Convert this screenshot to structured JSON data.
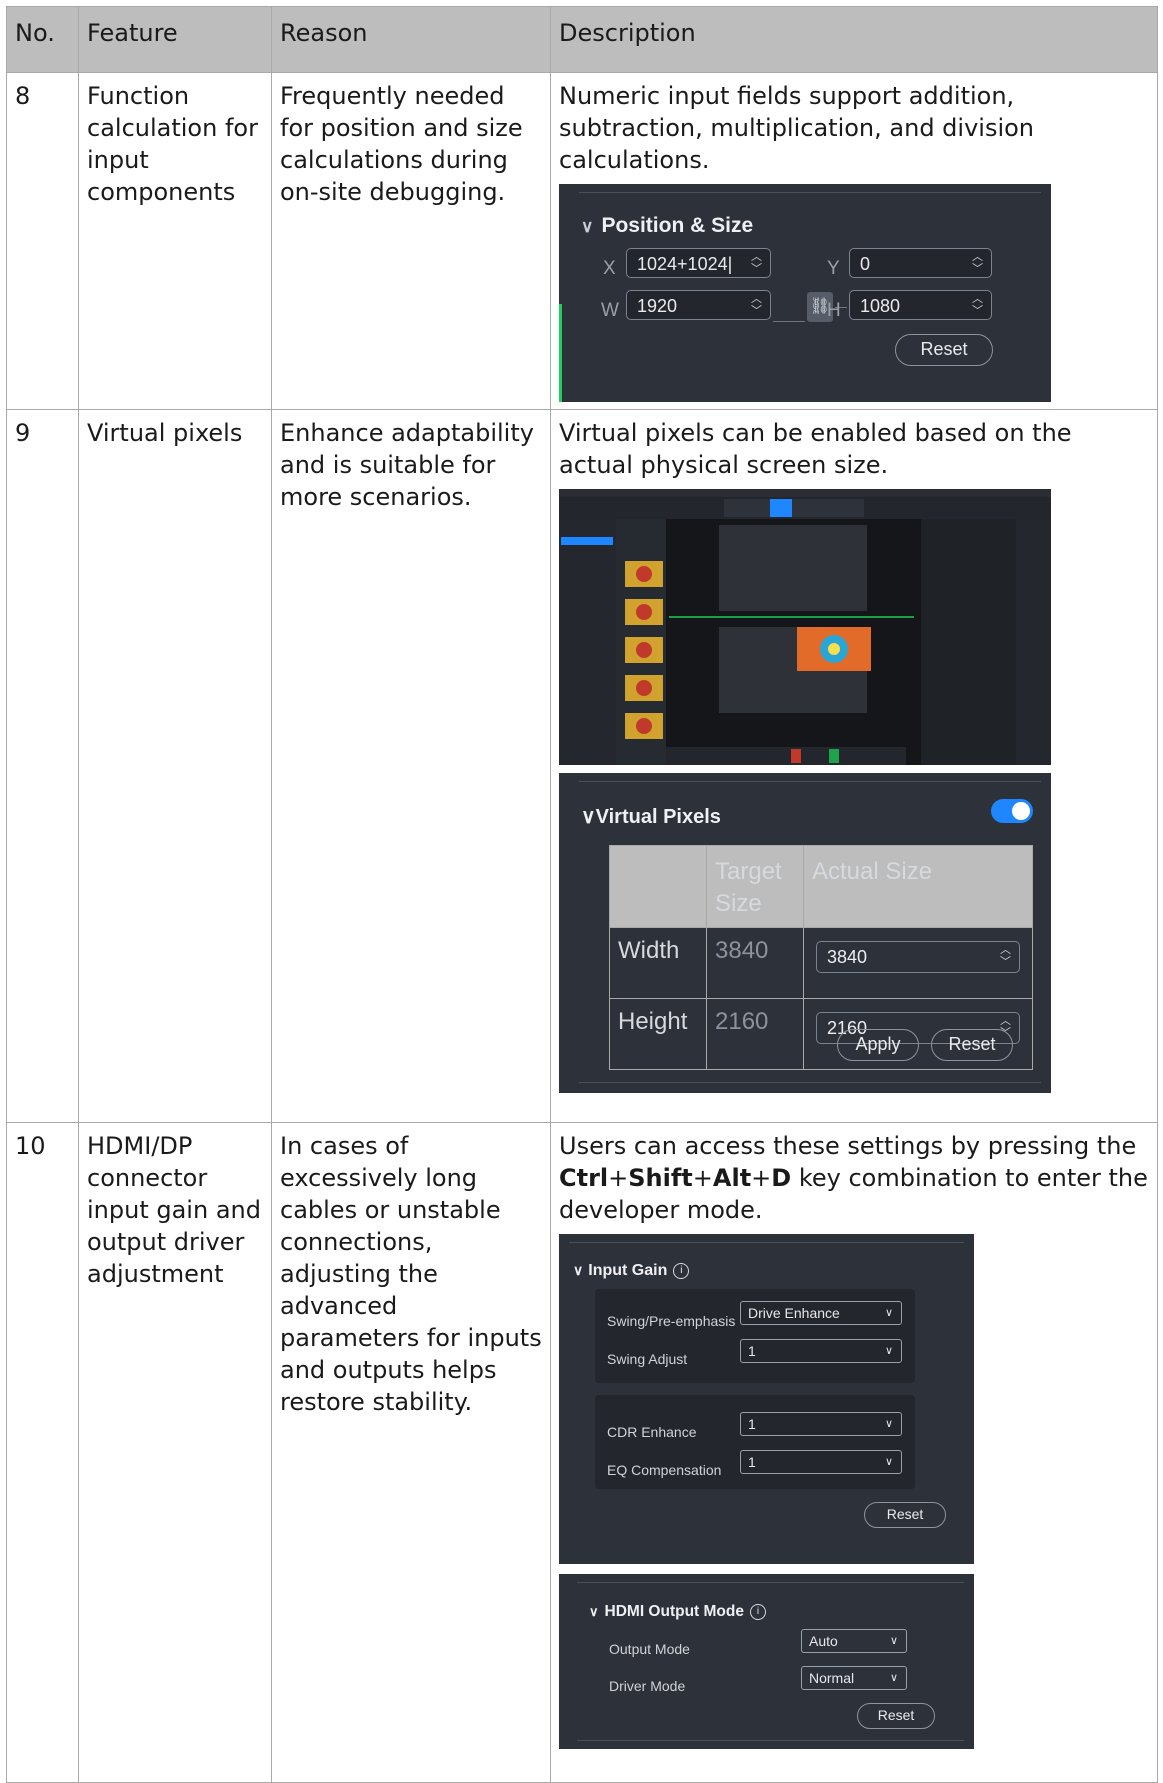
{
  "header": {
    "no": "No.",
    "feature": "Feature",
    "reason": "Reason",
    "description": "Description"
  },
  "rows": [
    {
      "no": "8",
      "feature": "Function calculation for input components",
      "reason": "Frequently needed for position and size calculations during on-site debugging.",
      "description": "Numeric input fields support addition, subtraction, multiplication, and division calculations.",
      "panel": {
        "title": "Position & Size",
        "x_label": "X",
        "x_value": "1024+1024",
        "y_label": "Y",
        "y_value": "0",
        "w_label": "W",
        "w_value": "1920",
        "h_label": "H",
        "h_value": "1080",
        "reset": "Reset"
      }
    },
    {
      "no": "9",
      "feature": "Virtual pixels",
      "reason": "Enhance adaptability and is suitable for more scenarios.",
      "description": "Virtual pixels can be enabled based on the actual physical screen size.",
      "panel": {
        "title": "Virtual Pixels",
        "enabled": true,
        "col_target": "Target Size",
        "col_actual": "Actual Size",
        "rows": [
          {
            "label": "Width",
            "target": "3840",
            "actual": "3840"
          },
          {
            "label": "Height",
            "target": "2160",
            "actual": "2160"
          }
        ],
        "apply": "Apply",
        "reset": "Reset"
      }
    },
    {
      "no": "10",
      "feature": "HDMI/DP connector input gain and output driver adjustment",
      "reason": "In cases of excessively long cables or unstable connections, adjusting the advanced parameters for inputs and outputs helps restore stability.",
      "description_pre": "Users can access these settings by pressing the ",
      "keys": [
        "Ctrl",
        "Shift",
        "Alt",
        "D"
      ],
      "plus": "+",
      "description_post": " key combination to enter the developer mode.",
      "input_gain": {
        "title": "Input Gain",
        "swing_label": "Swing/Pre-emphasis",
        "swing_value": "Drive Enhance",
        "swing_adjust_label": "Swing Adjust",
        "swing_adjust_value": "1",
        "cdr_label": "CDR Enhance",
        "cdr_value": "1",
        "eq_label": "EQ Compensation",
        "eq_value": "1",
        "reset": "Reset"
      },
      "hdmi_output": {
        "title": "HDMI Output Mode",
        "output_mode_label": "Output Mode",
        "output_mode_value": "Auto",
        "driver_mode_label": "Driver Mode",
        "driver_mode_value": "Normal",
        "reset": "Reset"
      }
    }
  ],
  "colors": {
    "panel_bg": "#2d3139",
    "accent_blue": "#1e86ff",
    "green_line": "#1fcf57",
    "header_bg": "#bdbdbd"
  }
}
